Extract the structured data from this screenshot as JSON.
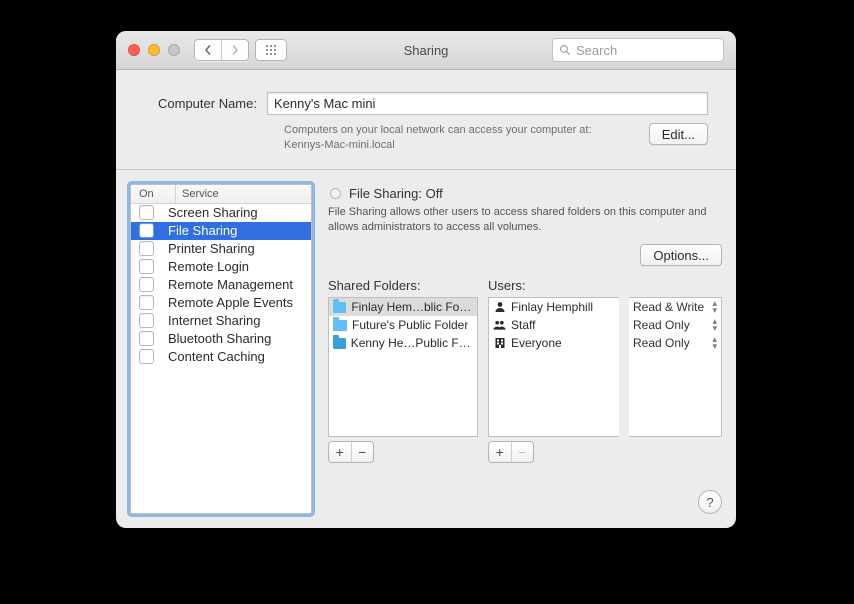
{
  "window": {
    "title": "Sharing",
    "search_placeholder": "Search"
  },
  "computer_name": {
    "label": "Computer Name:",
    "value": "Kenny's Mac mini",
    "subtext_line1": "Computers on your local network can access your computer at:",
    "subtext_line2": "Kennys-Mac-mini.local",
    "edit_label": "Edit..."
  },
  "services": {
    "col_on": "On",
    "col_service": "Service",
    "items": [
      {
        "label": "Screen Sharing",
        "on": false,
        "selected": false
      },
      {
        "label": "File Sharing",
        "on": false,
        "selected": true
      },
      {
        "label": "Printer Sharing",
        "on": false,
        "selected": false
      },
      {
        "label": "Remote Login",
        "on": false,
        "selected": false
      },
      {
        "label": "Remote Management",
        "on": false,
        "selected": false
      },
      {
        "label": "Remote Apple Events",
        "on": false,
        "selected": false
      },
      {
        "label": "Internet Sharing",
        "on": false,
        "selected": false
      },
      {
        "label": "Bluetooth Sharing",
        "on": false,
        "selected": false
      },
      {
        "label": "Content Caching",
        "on": false,
        "selected": false
      }
    ]
  },
  "detail": {
    "status_title": "File Sharing: Off",
    "description": "File Sharing allows other users to access shared folders on this computer and allows administrators to access all volumes.",
    "options_label": "Options..."
  },
  "shared_folders": {
    "label": "Shared Folders:",
    "items": [
      {
        "name": "Finlay Hem…blic Folder",
        "selected": true,
        "drop": false
      },
      {
        "name": "Future's Public Folder",
        "selected": false,
        "drop": false
      },
      {
        "name": "Kenny He…Public Folder",
        "selected": false,
        "drop": true
      }
    ]
  },
  "users": {
    "label": "Users:",
    "items": [
      {
        "name": "Finlay Hemphill",
        "icon": "person"
      },
      {
        "name": "Staff",
        "icon": "group"
      },
      {
        "name": "Everyone",
        "icon": "building"
      }
    ]
  },
  "permissions": {
    "items": [
      {
        "label": "Read & Write"
      },
      {
        "label": "Read Only"
      },
      {
        "label": "Read Only"
      }
    ]
  },
  "help_label": "?"
}
